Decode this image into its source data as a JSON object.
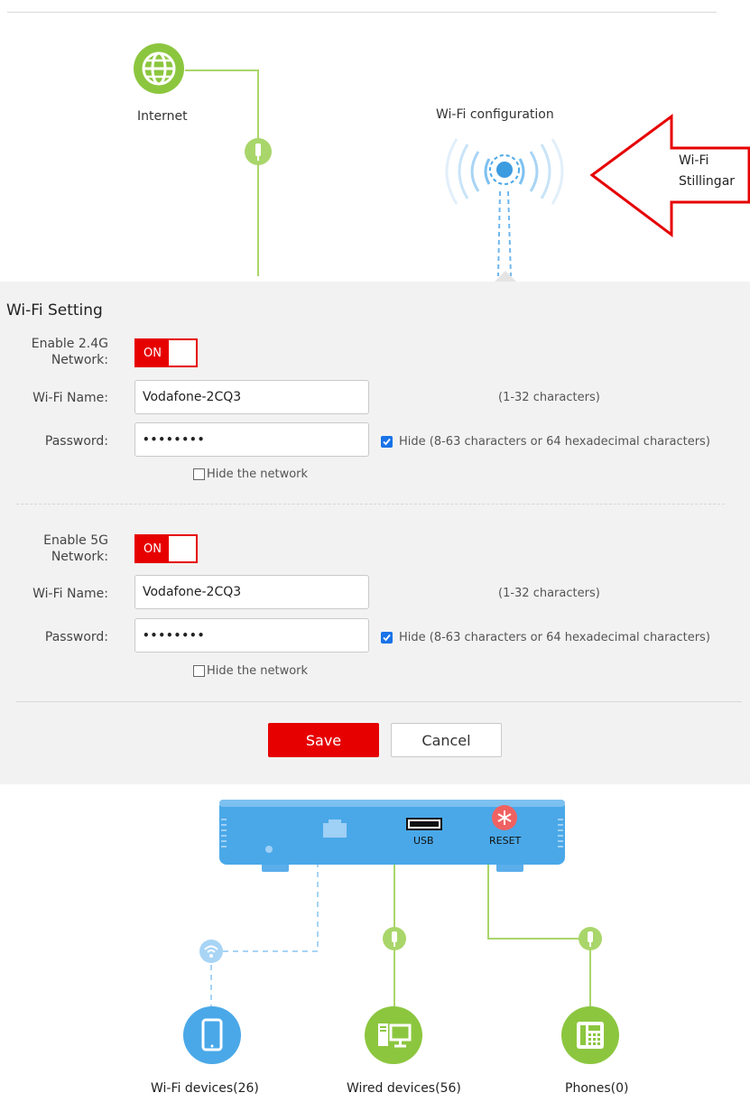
{
  "topology": {
    "internet_label": "Internet",
    "wifi_config_label": "Wi-Fi configuration",
    "annotation_line1": "Wi-Fi",
    "annotation_line2": "Stillingar"
  },
  "wifi_setting": {
    "title": "Wi-Fi Setting",
    "band_24": {
      "enable_label_line1": "Enable 2.4G",
      "enable_label_line2": "Network:",
      "toggle": "ON",
      "name_label": "Wi-Fi Name:",
      "name_value": "Vodafone-2CQ3",
      "name_hint": "(1-32 characters)",
      "password_label": "Password:",
      "password_value": "••••••••",
      "hide_password_label": "Hide (8-63 characters or 64 hexadecimal characters)",
      "hide_network_label": "Hide the network"
    },
    "band_5": {
      "enable_label_line1": "Enable 5G",
      "enable_label_line2": "Network:",
      "toggle": "ON",
      "name_label": "Wi-Fi Name:",
      "name_value": "Vodafone-2CQ3",
      "name_hint": "(1-32 characters)",
      "password_label": "Password:",
      "password_value": "••••••••",
      "hide_password_label": "Hide (8-63 characters or 64 hexadecimal characters)",
      "hide_network_label": "Hide the network"
    },
    "save_label": "Save",
    "cancel_label": "Cancel"
  },
  "router": {
    "usb_label": "USB",
    "reset_label": "RESET"
  },
  "devices": {
    "wifi_devices": "Wi-Fi devices(26)",
    "wired_devices": "Wired devices(56)",
    "phones": "Phones(0)"
  },
  "colors": {
    "accent_red": "#e60000",
    "green": "#8cc63f",
    "blue": "#4aa8e8"
  }
}
